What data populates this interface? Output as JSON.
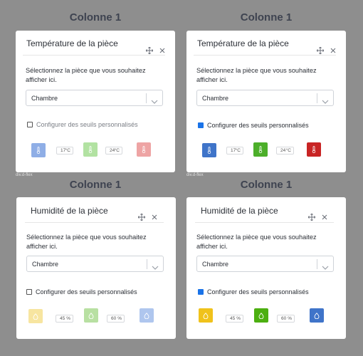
{
  "columns": [
    "Colonne 1",
    "Colonne 1",
    "Colonne 1",
    "Colonne 1"
  ],
  "cards": [
    {
      "title": "Température de la pièce",
      "description": "Sélectionnez la pièce que vous souhaitez afficher ici.",
      "select_value": "Chambre",
      "checkbox_label": "Configurer des seuils personnalisés",
      "checkbox_checked": false,
      "low_value": "17",
      "low_unit": "°C",
      "high_value": "24",
      "high_unit": "°C",
      "swatch_colors": [
        "#8faee6",
        "#b2e2a2",
        "#eea4a4"
      ],
      "icon": "thermometer-icon"
    },
    {
      "title": "Température de la pièce",
      "description": "Sélectionnez la pièce que vous souhaitez afficher ici.",
      "select_value": "Chambre",
      "checkbox_label": "Configurer des seuils personnalisés",
      "checkbox_checked": true,
      "low_value": "17",
      "low_unit": "°C",
      "high_value": "24",
      "high_unit": "°C",
      "swatch_colors": [
        "#3f74c9",
        "#4caf2a",
        "#c82424"
      ],
      "icon": "thermometer-icon"
    },
    {
      "title": "Humidité de la pièce",
      "description": "Sélectionnez la pièce que vous souhaitez afficher ici.",
      "select_value": "Chambre",
      "checkbox_label": "Configurer des seuils personnalisés",
      "checkbox_checked": false,
      "low_value": "45",
      "low_unit": "%",
      "high_value": "60",
      "high_unit": "%",
      "swatch_colors": [
        "#f7e5a0",
        "#b8e0a2",
        "#afc6ee"
      ],
      "icon": "droplet-icon"
    },
    {
      "title": "Humidité de la pièce",
      "description": "Sélectionnez la pièce que vous souhaitez afficher ici.",
      "select_value": "Chambre",
      "checkbox_label": "Configurer des seuils personnalisés",
      "checkbox_checked": true,
      "low_value": "45",
      "low_unit": "%",
      "high_value": "60",
      "high_unit": "%",
      "swatch_colors": [
        "#f0c21b",
        "#4caf10",
        "#3f74c9"
      ],
      "icon": "droplet-icon"
    }
  ],
  "debug_labels": [
    "div.d-flex",
    "div.d-flex"
  ]
}
